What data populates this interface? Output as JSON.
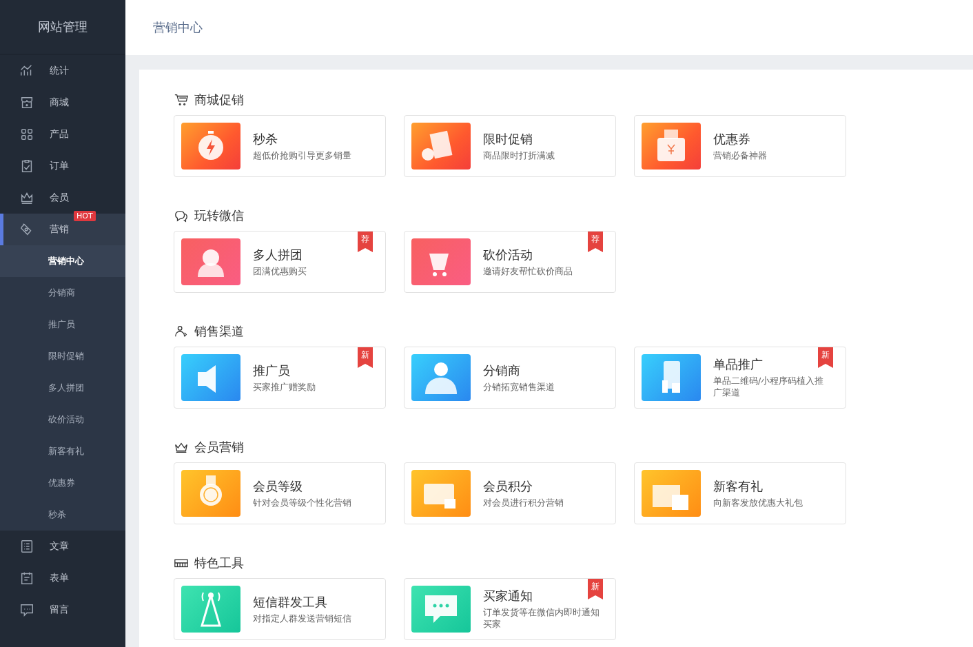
{
  "sidebar": {
    "title": "网站管理",
    "items": [
      {
        "label": "统计",
        "selected": false
      },
      {
        "label": "商城",
        "selected": false
      },
      {
        "label": "产品",
        "selected": false
      },
      {
        "label": "订单",
        "selected": false
      },
      {
        "label": "会员",
        "selected": false
      },
      {
        "label": "营销",
        "selected": true,
        "expanded": true,
        "badge": "HOT",
        "children": [
          {
            "label": "营销中心",
            "selected": true
          },
          {
            "label": "分销商",
            "selected": false
          },
          {
            "label": "推广员",
            "selected": false
          },
          {
            "label": "限时促销",
            "selected": false
          },
          {
            "label": "多人拼团",
            "selected": false
          },
          {
            "label": "砍价活动",
            "selected": false
          },
          {
            "label": "新客有礼",
            "selected": false
          },
          {
            "label": "优惠券",
            "selected": false
          },
          {
            "label": "秒杀",
            "selected": false
          }
        ]
      },
      {
        "label": "文章",
        "selected": false
      },
      {
        "label": "表单",
        "selected": false
      },
      {
        "label": "留言",
        "selected": false
      }
    ]
  },
  "page_title": "营销中心",
  "sections": [
    {
      "title": "商城促销",
      "cards": [
        {
          "title": "秒杀",
          "desc": "超低价抢购引导更多销量"
        },
        {
          "title": "限时促销",
          "desc": "商品限时打折满减"
        },
        {
          "title": "优惠券",
          "desc": "营销必备神器"
        }
      ]
    },
    {
      "title": "玩转微信",
      "cards": [
        {
          "title": "多人拼团",
          "desc": "团满优惠购买",
          "badge": "荐"
        },
        {
          "title": "砍价活动",
          "desc": "邀请好友帮忙砍价商品",
          "badge": "荐"
        }
      ]
    },
    {
      "title": "销售渠道",
      "cards": [
        {
          "title": "推广员",
          "desc": "买家推广赠奖励",
          "badge": "新"
        },
        {
          "title": "分销商",
          "desc": "分销拓宽销售渠道"
        },
        {
          "title": "单品推广",
          "desc": "单品二维码/小程序码植入推广渠道",
          "badge": "新"
        }
      ]
    },
    {
      "title": "会员营销",
      "cards": [
        {
          "title": "会员等级",
          "desc": "针对会员等级个性化营销"
        },
        {
          "title": "会员积分",
          "desc": "对会员进行积分营销"
        },
        {
          "title": "新客有礼",
          "desc": "向新客发放优惠大礼包"
        }
      ]
    },
    {
      "title": "特色工具",
      "cards": [
        {
          "title": "短信群发工具",
          "desc": "对指定人群发送营销短信"
        },
        {
          "title": "买家通知",
          "desc": "订单发货等在微信内即时通知买家",
          "badge": "新"
        }
      ]
    }
  ]
}
